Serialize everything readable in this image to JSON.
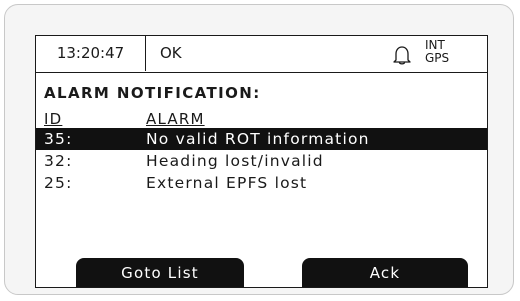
{
  "statusbar": {
    "time": "13:20:47",
    "status": "OK",
    "alarm_icon": "bell-icon",
    "source_line1": "INT",
    "source_line2": "GPS"
  },
  "title": "ALARM NOTIFICATION:",
  "columns": {
    "id": "ID",
    "alarm": "ALARM"
  },
  "alarms": [
    {
      "id": "35:",
      "text": "No valid ROT information",
      "selected": true
    },
    {
      "id": "32:",
      "text": "Heading lost/invalid",
      "selected": false
    },
    {
      "id": "25:",
      "text": "External EPFS lost",
      "selected": false
    }
  ],
  "softkeys": {
    "left": "Goto List",
    "right": "Ack"
  }
}
